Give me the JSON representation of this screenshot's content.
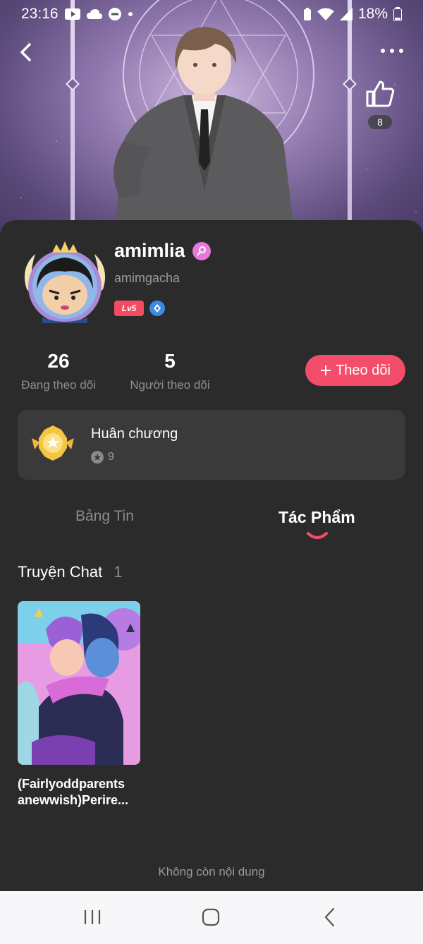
{
  "status_bar": {
    "time": "23:16",
    "battery": "18%"
  },
  "profile": {
    "username": "amimlia",
    "handle": "amimgacha",
    "level": "Lv5"
  },
  "like": {
    "count": "8"
  },
  "stats": {
    "following_count": "26",
    "following_label": "Đang theo dõi",
    "followers_count": "5",
    "followers_label": "Người theo dõi"
  },
  "follow_button": {
    "label": "Theo dõi"
  },
  "medal": {
    "title": "Huân chương",
    "count": "9"
  },
  "tabs": [
    {
      "label": "Bảng Tin"
    },
    {
      "label": "Tác Phẩm"
    }
  ],
  "section": {
    "title": "Truyện Chat",
    "count": "1"
  },
  "stories": [
    {
      "title": "(Fairlyoddparents anewwish)Perire..."
    }
  ],
  "footer": {
    "end_text": "Không còn nội dung"
  },
  "colors": {
    "accent": "#f44d69",
    "background": "#2b2b2b",
    "card": "#3a3a3a"
  }
}
